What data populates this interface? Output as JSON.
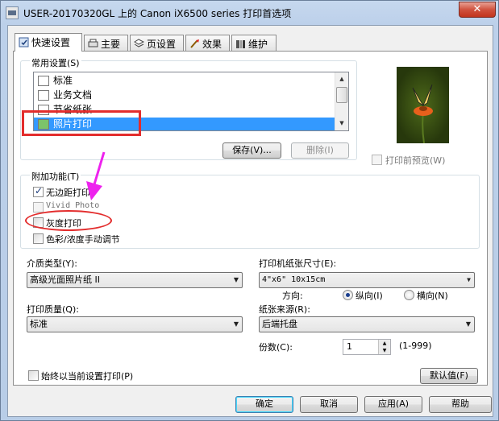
{
  "window": {
    "title": "USER-20170320GL 上的 Canon iX6500 series 打印首选项",
    "close_glyph": "✕"
  },
  "tabs": [
    {
      "label": "快速设置",
      "icon": "quick-setup-icon",
      "active": true
    },
    {
      "label": "主要",
      "icon": "main-icon",
      "active": false
    },
    {
      "label": "页设置",
      "icon": "page-setup-icon",
      "active": false
    },
    {
      "label": "效果",
      "icon": "effects-icon",
      "active": false
    },
    {
      "label": "维护",
      "icon": "maintenance-icon",
      "active": false
    }
  ],
  "common_settings": {
    "label": "常用设置(S)",
    "items": [
      {
        "label": "标准",
        "selected": false
      },
      {
        "label": "业务文档",
        "selected": false
      },
      {
        "label": "节省纸张",
        "selected": false
      },
      {
        "label": "照片打印",
        "selected": true
      }
    ],
    "save_button": "保存(V)...",
    "delete_button": "删除(I)"
  },
  "preview": {
    "checkbox_label": "打印前预览(W)",
    "checked": false
  },
  "additional_features": {
    "label": "附加功能(T)",
    "items": [
      {
        "label": "无边距打印",
        "checked": true,
        "enabled": true
      },
      {
        "label": "Vivid Photo",
        "checked": false,
        "enabled": false
      },
      {
        "label": "灰度打印",
        "checked": false,
        "enabled": true
      },
      {
        "label": "色彩/浓度手动调节",
        "checked": false,
        "enabled": true
      }
    ]
  },
  "media_type": {
    "label": "介质类型(Y):",
    "value": "高级光面照片纸 II"
  },
  "printer_paper_size": {
    "label": "打印机纸张尺寸(E):",
    "value": "4\"x6\" 10x15cm"
  },
  "orientation": {
    "label": "方向:",
    "options": [
      {
        "label": "纵向(I)",
        "selected": true
      },
      {
        "label": "横向(N)",
        "selected": false
      }
    ]
  },
  "print_quality": {
    "label": "打印质量(Q):",
    "value": "标准"
  },
  "paper_source": {
    "label": "纸张来源(R):",
    "value": "后端托盘"
  },
  "copies": {
    "label": "份数(C):",
    "value": "1",
    "range": "(1-999)"
  },
  "always_print": {
    "label": "始终以当前设置打印(P)",
    "checked": false
  },
  "defaults_button": "默认值(F)",
  "bottom_buttons": {
    "ok": "确定",
    "cancel": "取消",
    "apply": "应用(A)",
    "help": "帮助"
  },
  "colors": {
    "selection": "#3399ff",
    "annotation": "#e32d2d",
    "arrow": "#ee22ee"
  }
}
